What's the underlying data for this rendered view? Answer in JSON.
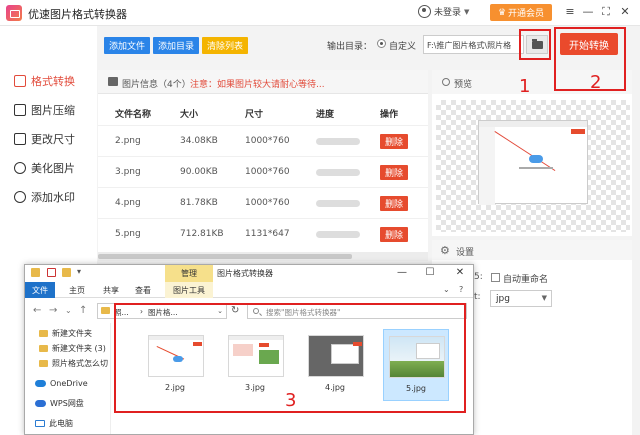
{
  "app": {
    "title": "优速图片格式转换器",
    "user_label": "未登录",
    "vip_label": "开通会员",
    "window_controls": {
      "menu": "≡",
      "minimize": "—",
      "maximize": "⛶",
      "close": "✕"
    }
  },
  "sidebar": {
    "items": [
      {
        "label": "格式转换",
        "icon": "format-convert-icon",
        "active": true
      },
      {
        "label": "图片压缩",
        "icon": "compress-icon",
        "active": false
      },
      {
        "label": "更改尺寸",
        "icon": "resize-icon",
        "active": false
      },
      {
        "label": "美化图片",
        "icon": "beautify-icon",
        "active": false
      },
      {
        "label": "添加水印",
        "icon": "watermark-icon",
        "active": false
      }
    ]
  },
  "toolbar": {
    "add_file": "添加文件",
    "add_folder": "添加目录",
    "clear_list": "清除列表",
    "output_label": "输出目录：",
    "custom_label": "自定义",
    "output_path": "F:\\推广图片格式\\照片格",
    "start_label": "开始转换"
  },
  "file_panel": {
    "title": "图片信息（4个）",
    "notice": "注意：如果图片较大请耐心等待...",
    "columns": [
      "文件名称",
      "大小",
      "尺寸",
      "进度",
      "操作"
    ],
    "rows": [
      {
        "name": "2.png",
        "size": "34.08KB",
        "dims": "1000*760",
        "progress": 0.9,
        "action": "删除"
      },
      {
        "name": "3.png",
        "size": "90.00KB",
        "dims": "1000*760",
        "progress": 0.9,
        "action": "删除"
      },
      {
        "name": "4.png",
        "size": "81.78KB",
        "dims": "1000*760",
        "progress": 0.9,
        "action": "删除"
      },
      {
        "name": "5.png",
        "size": "712.81KB",
        "dims": "1131*647",
        "progress": 0.9,
        "action": "删除"
      }
    ]
  },
  "preview": {
    "label": "预览"
  },
  "settings": {
    "label": "设置",
    "fragment_1": "5:",
    "fragment_2": "t:",
    "auto_rename": "自动重命名",
    "format": "jpg"
  },
  "explorer": {
    "manage_tab": "管理",
    "title": "图片格式转换器",
    "ribbon_tabs": {
      "file": "文件",
      "home": "主页",
      "share": "共享",
      "view": "查看",
      "tools": "图片工具"
    },
    "address": {
      "crumb_1": "照...",
      "sep": "›",
      "crumb_2": "图片格..."
    },
    "search_placeholder": "搜索\"图片格式转换器\"",
    "nav": [
      {
        "label": "新建文件夹",
        "type": "folder"
      },
      {
        "label": "新建文件夹 (3)",
        "type": "folder"
      },
      {
        "label": "照片格式怎么切",
        "type": "folder"
      },
      {
        "label": "OneDrive",
        "type": "onedrive"
      },
      {
        "label": "WPS网盘",
        "type": "wps"
      },
      {
        "label": "此电脑",
        "type": "pc"
      }
    ],
    "files": [
      "2.jpg",
      "3.jpg",
      "4.jpg",
      "5.jpg"
    ]
  },
  "annotations": [
    "1",
    "2",
    "3"
  ],
  "colors": {
    "accent_red": "#e24b3b",
    "start_red": "#ea4a2c",
    "blue": "#2a84e8",
    "vip_orange": "#f7902f",
    "toolbar_yellow": "#f4b400"
  }
}
